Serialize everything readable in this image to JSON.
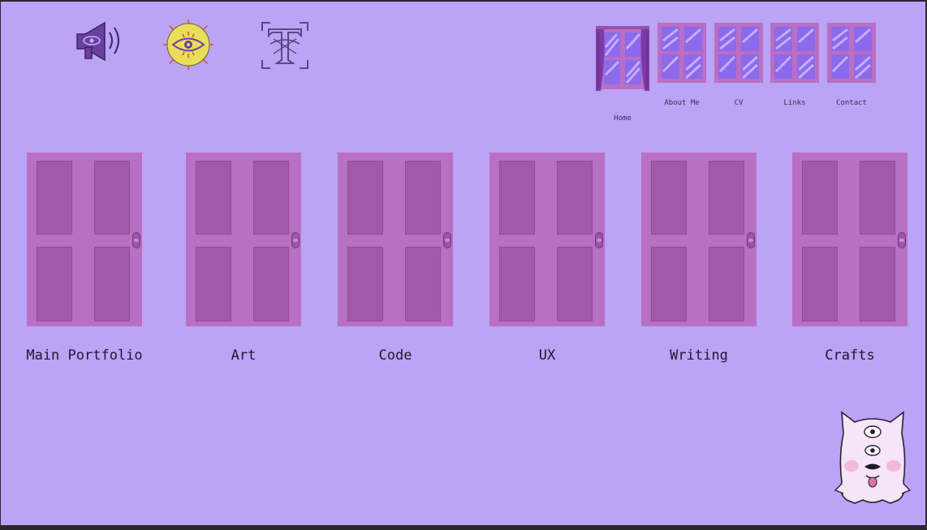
{
  "toolbar": {
    "sound_icon": "megaphone-eye-icon",
    "theme_icon": "sun-eye-icon",
    "text_icon": "text-cursor-icon",
    "accent_color": "#6b3fa0",
    "sun_color": "#e8de5a"
  },
  "nav": {
    "items": [
      {
        "label": "Home",
        "icon": "window-curtains-icon",
        "active": true
      },
      {
        "label": "About Me",
        "icon": "window-icon"
      },
      {
        "label": "CV",
        "icon": "window-icon"
      },
      {
        "label": "Links",
        "icon": "window-icon"
      },
      {
        "label": "Contact",
        "icon": "window-icon"
      }
    ]
  },
  "doors": [
    {
      "label": "Main Portfolio"
    },
    {
      "label": "Art"
    },
    {
      "label": "Code"
    },
    {
      "label": "UX"
    },
    {
      "label": "Writing"
    },
    {
      "label": "Crafts"
    }
  ],
  "theme": {
    "background": "#bba3f6",
    "door_color": "#b96fc4",
    "door_panel_color": "#a15aab",
    "window_frame_color": "#b96fc4",
    "window_glass_color": "#8d69ec"
  },
  "mascot": {
    "icon": "three-eyed-creature-icon"
  }
}
